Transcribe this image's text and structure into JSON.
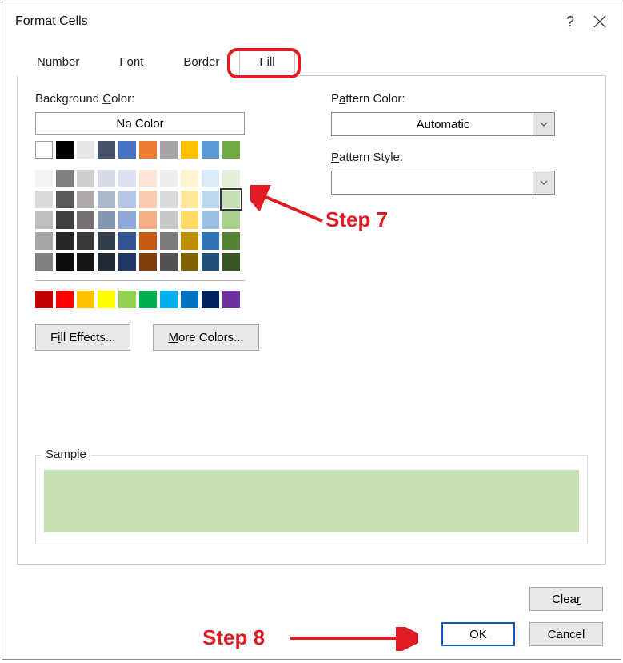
{
  "dialog": {
    "title": "Format Cells",
    "help_label": "?",
    "close_label": "Close"
  },
  "tabs": [
    {
      "label": "Number",
      "active": false
    },
    {
      "label": "Font",
      "active": false
    },
    {
      "label": "Border",
      "active": false
    },
    {
      "label": "Fill",
      "active": true
    }
  ],
  "fill_panel": {
    "bg_color_label": "Background Color:",
    "no_color_label": "No Color",
    "fill_effects_label": "Fill Effects...",
    "more_colors_label": "More Colors...",
    "pattern_color_label": "Pattern Color:",
    "pattern_color_value": "Automatic",
    "pattern_style_label": "Pattern Style:",
    "sample_label": "Sample",
    "sample_color": "#c5e0b4"
  },
  "palette": {
    "theme_row": [
      "#ffffff",
      "#000000",
      "#e7e6e6",
      "#44546a",
      "#4472c4",
      "#ed7d31",
      "#a5a5a5",
      "#ffc000",
      "#5b9bd5",
      "#70ad47"
    ],
    "tints": [
      [
        "#f2f2f2",
        "#808080",
        "#d0cece",
        "#d6dce5",
        "#d9e1f2",
        "#fce4d6",
        "#ededed",
        "#fff2cc",
        "#ddebf7",
        "#e2efda"
      ],
      [
        "#d9d9d9",
        "#595959",
        "#aeaaaa",
        "#acb9ca",
        "#b4c6e7",
        "#f8cbad",
        "#dbdbdb",
        "#ffe699",
        "#bdd7ee",
        "#c5e0b4"
      ],
      [
        "#bfbfbf",
        "#404040",
        "#757171",
        "#8497b0",
        "#8ea9db",
        "#f4b084",
        "#c9c9c9",
        "#ffd966",
        "#9bc2e6",
        "#a9d08e"
      ],
      [
        "#a6a6a6",
        "#262626",
        "#3a3838",
        "#333f4f",
        "#305496",
        "#c65911",
        "#7b7b7b",
        "#bf8f00",
        "#2f75b5",
        "#548235"
      ],
      [
        "#808080",
        "#0d0d0d",
        "#161616",
        "#222b35",
        "#203764",
        "#833c0c",
        "#525252",
        "#806000",
        "#1f4e78",
        "#375623"
      ]
    ],
    "standard": [
      "#c00000",
      "#ff0000",
      "#ffc000",
      "#ffff00",
      "#92d050",
      "#00b050",
      "#00b0f0",
      "#0070c0",
      "#002060",
      "#7030a0"
    ],
    "selected_color": "#c5e0b4"
  },
  "buttons": {
    "clear": "Clear",
    "ok": "OK",
    "cancel": "Cancel"
  },
  "annotations": {
    "step7": "Step 7",
    "step8": "Step 8"
  }
}
